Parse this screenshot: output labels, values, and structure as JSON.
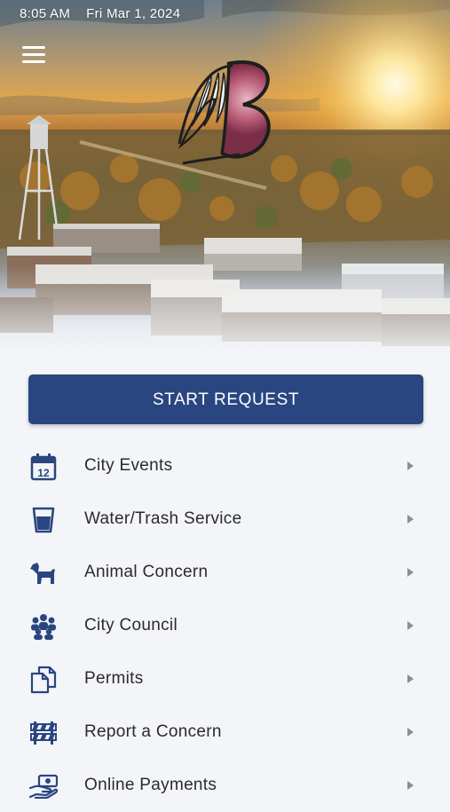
{
  "status_bar": {
    "time": "8:05 AM",
    "date": "Fri Mar 1, 2024"
  },
  "header": {
    "menu_icon": "hamburger-menu-icon",
    "logo_icon": "city-logo-feathers-b"
  },
  "start_request": {
    "label": "START REQUEST"
  },
  "colors": {
    "primary": "#2a4680",
    "icon": "#2a4680",
    "background": "#f3f5f8",
    "text": "#2b2b2b"
  },
  "menu": {
    "items": [
      {
        "label": "City Events",
        "icon": "calendar-icon"
      },
      {
        "label": "Water/Trash Service",
        "icon": "water-cup-icon"
      },
      {
        "label": "Animal Concern",
        "icon": "dog-icon"
      },
      {
        "label": "City Council",
        "icon": "group-people-icon"
      },
      {
        "label": "Permits",
        "icon": "documents-icon"
      },
      {
        "label": "Report a Concern",
        "icon": "barricade-icon"
      },
      {
        "label": "Online Payments",
        "icon": "payment-hand-icon"
      }
    ]
  }
}
